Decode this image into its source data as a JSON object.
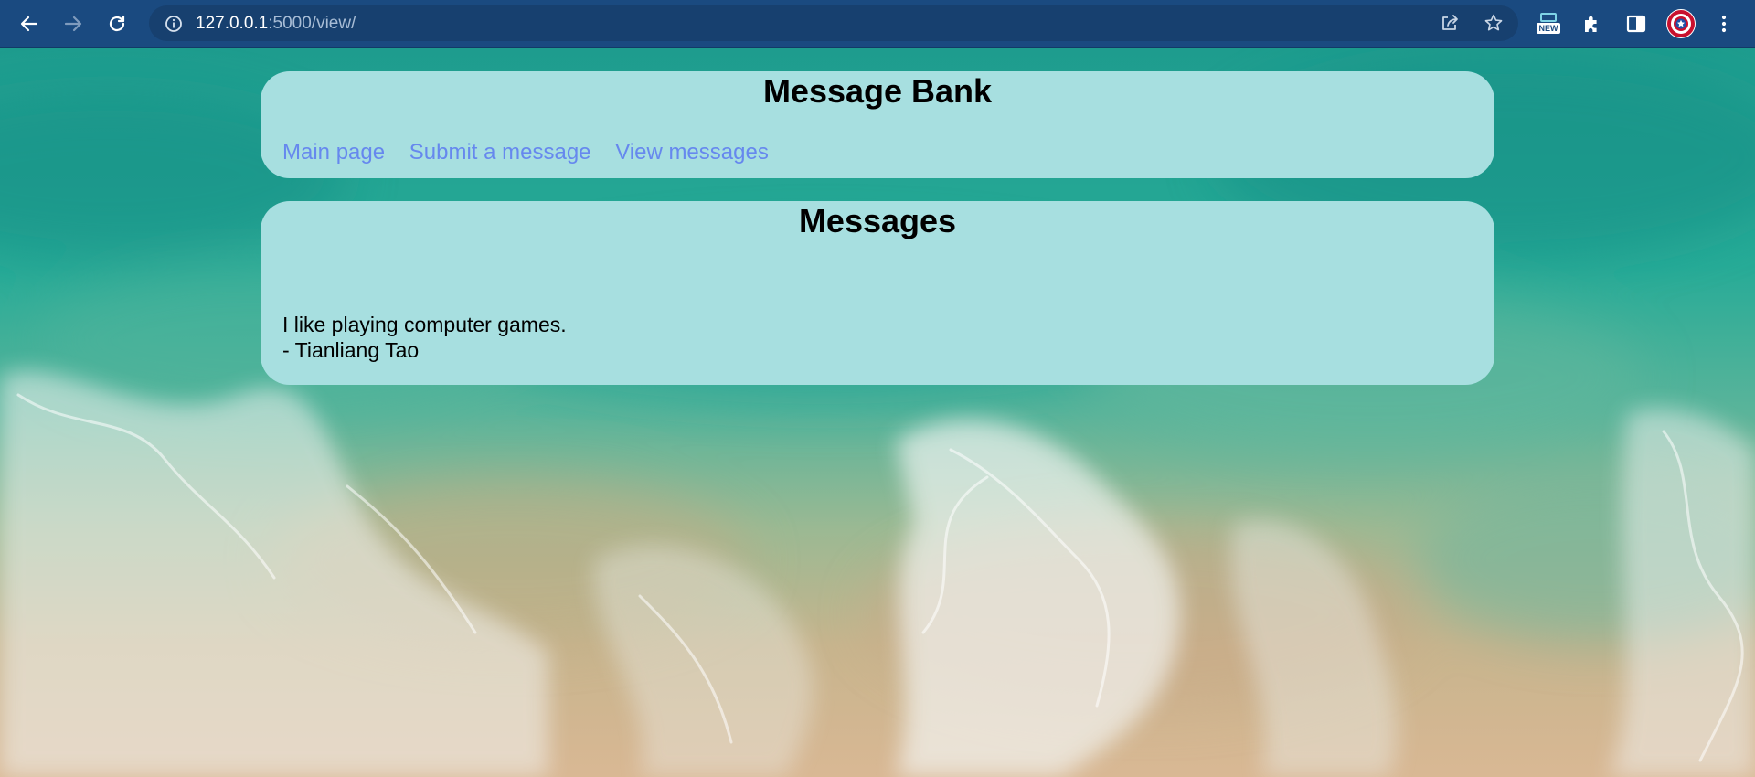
{
  "browser": {
    "url_host": "127.0.0.1",
    "url_path": ":5000/view/",
    "extension_badge": "NEW",
    "toolbar_color": "#1a4a80",
    "icons": [
      "back-arrow-icon",
      "forward-arrow-icon",
      "reload-icon",
      "info-icon",
      "share-icon",
      "star-icon",
      "extension-new-icon",
      "puzzle-icon",
      "side-panel-icon",
      "profile-avatar",
      "more-vert-icon"
    ]
  },
  "header": {
    "title": "Message Bank",
    "nav": [
      {
        "label": "Main page"
      },
      {
        "label": "Submit a message"
      },
      {
        "label": "View messages"
      }
    ]
  },
  "messages": {
    "title": "Messages",
    "items": [
      {
        "text": "I like playing computer games.",
        "author": "- Tianliang Tao"
      }
    ]
  },
  "colors": {
    "card_background": "#a7dfe0",
    "link": "#6688ee",
    "ocean_background": "#2aa89a"
  }
}
